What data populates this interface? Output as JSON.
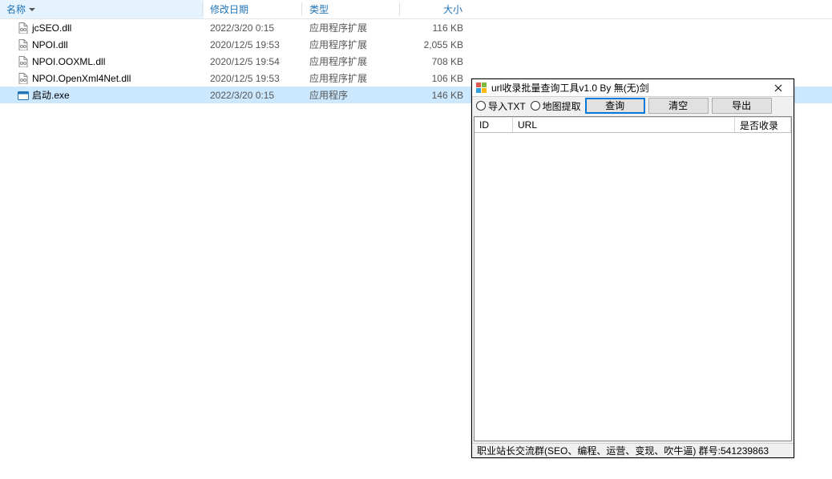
{
  "explorer": {
    "columns": {
      "name": "名称",
      "date": "修改日期",
      "type": "类型",
      "size": "大小"
    },
    "files": [
      {
        "icon": "dll",
        "name": "jcSEO.dll",
        "date": "2022/3/20 0:15",
        "type": "应用程序扩展",
        "size": "116 KB"
      },
      {
        "icon": "dll",
        "name": "NPOI.dll",
        "date": "2020/12/5 19:53",
        "type": "应用程序扩展",
        "size": "2,055 KB"
      },
      {
        "icon": "dll",
        "name": "NPOI.OOXML.dll",
        "date": "2020/12/5 19:54",
        "type": "应用程序扩展",
        "size": "708 KB"
      },
      {
        "icon": "dll",
        "name": "NPOI.OpenXml4Net.dll",
        "date": "2020/12/5 19:53",
        "type": "应用程序扩展",
        "size": "106 KB"
      },
      {
        "icon": "exe",
        "name": "启动.exe",
        "date": "2022/3/20 0:15",
        "type": "应用程序",
        "size": "146 KB",
        "selected": true
      }
    ]
  },
  "tool": {
    "title": "url收录批量查询工具v1.0 By 無(无)剑",
    "radios": {
      "importTxt": "导入TXT",
      "mapExtract": "地图提取"
    },
    "buttons": {
      "query": "查询",
      "clear": "清空",
      "export": "导出"
    },
    "grid": {
      "id": "ID",
      "url": "URL",
      "included": "是否收录"
    },
    "status": "职业站长交流群(SEO、编程、运营、变现、吹牛逼) 群号:541239863"
  }
}
